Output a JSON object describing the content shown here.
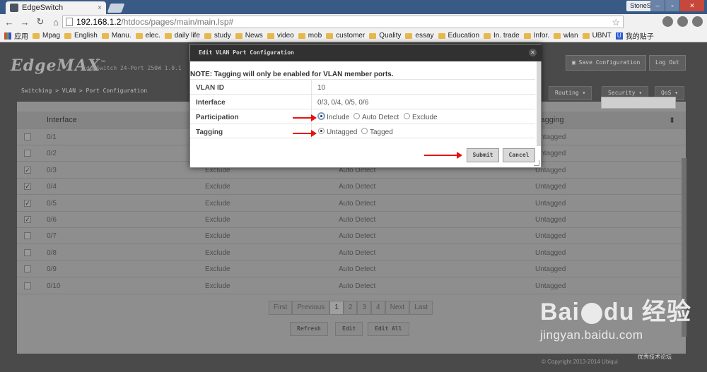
{
  "browser": {
    "tab_title": "EdgeSwitch",
    "tab_close": "×",
    "user_name": "StoneS",
    "url_host": "192.168.1.2",
    "url_path": "/htdocs/pages/main/main.lsp#",
    "bookmarks": [
      "应用",
      "Mpag",
      "English",
      "Manu.",
      "elec.",
      "daily life",
      "study",
      "News",
      "video",
      "mob",
      "customer",
      "Quality",
      "essay",
      "Education",
      "In. trade",
      "Infor.",
      "wlan",
      "UBNT",
      "我的贴子"
    ]
  },
  "header": {
    "logo": "EdgeMAX",
    "logo_mark": "™",
    "product": "EdgeSwitch 24-Port 250W 1.0.1",
    "save_label": "Save Configuration",
    "logout_label": "Log Out"
  },
  "breadcrumb": "Switching > VLAN > Port Configuration",
  "menus": [
    "Routing",
    "Security",
    "QoS"
  ],
  "grid": {
    "columns": [
      "Interface",
      "Tagging"
    ],
    "rows": [
      {
        "checked": false,
        "interface": "0/1",
        "participation": "",
        "auto": "",
        "tagging": "Untagged"
      },
      {
        "checked": false,
        "interface": "0/2",
        "participation": "",
        "auto": "",
        "tagging": "Untagged"
      },
      {
        "checked": true,
        "interface": "0/3",
        "participation": "Exclude",
        "auto": "Auto Detect",
        "tagging": "Untagged"
      },
      {
        "checked": true,
        "interface": "0/4",
        "participation": "Exclude",
        "auto": "Auto Detect",
        "tagging": "Untagged"
      },
      {
        "checked": true,
        "interface": "0/5",
        "participation": "Exclude",
        "auto": "Auto Detect",
        "tagging": "Untagged"
      },
      {
        "checked": true,
        "interface": "0/6",
        "participation": "Exclude",
        "auto": "Auto Detect",
        "tagging": "Untagged"
      },
      {
        "checked": false,
        "interface": "0/7",
        "participation": "Exclude",
        "auto": "Auto Detect",
        "tagging": "Untagged"
      },
      {
        "checked": false,
        "interface": "0/8",
        "participation": "Exclude",
        "auto": "Auto Detect",
        "tagging": "Untagged"
      },
      {
        "checked": false,
        "interface": "0/9",
        "participation": "Exclude",
        "auto": "Auto Detect",
        "tagging": "Untagged"
      },
      {
        "checked": false,
        "interface": "0/10",
        "participation": "Exclude",
        "auto": "Auto Detect",
        "tagging": "Untagged"
      }
    ]
  },
  "pager": [
    "First",
    "Previous",
    "1",
    "2",
    "3",
    "4",
    "Next",
    "Last"
  ],
  "actions": [
    "Refresh",
    "Edit",
    "Edit All"
  ],
  "copyright": "© Copyright 2013-2014 Ubiqui",
  "modal": {
    "title": "Edit VLAN Port Configuration",
    "note": "NOTE: Tagging will only be enabled for VLAN member ports.",
    "vlan_id_label": "VLAN ID",
    "vlan_id": "10",
    "interface_label": "Interface",
    "interface_value": "0/3, 0/4, 0/5, 0/6",
    "participation_label": "Participation",
    "participation_options": [
      "Include",
      "Auto Detect",
      "Exclude"
    ],
    "participation_selected": "Include",
    "tagging_label": "Tagging",
    "tagging_options": [
      "Untagged",
      "Tagged"
    ],
    "tagging_selected": "Untagged",
    "submit_label": "Submit",
    "cancel_label": "Cancel"
  },
  "watermark": {
    "brand": "Bai",
    "brand2": "du",
    "brand_cn": "经验",
    "url": "jingyan.baidu.com",
    "corner": "优秀技术论坛"
  },
  "colors": {
    "annotation_arrow": "#e81010",
    "modal_title_bar": "#313131"
  }
}
